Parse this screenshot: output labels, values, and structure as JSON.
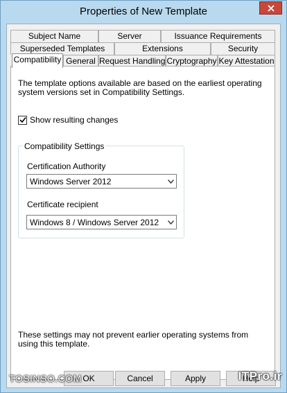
{
  "window": {
    "title": "Properties of New Template"
  },
  "tabs": {
    "row1": [
      "Subject Name",
      "Server",
      "Issuance Requirements"
    ],
    "row2": [
      "Superseded Templates",
      "Extensions",
      "Security"
    ],
    "row3": [
      "Compatibility",
      "General",
      "Request Handling",
      "Cryptography",
      "Key Attestation"
    ],
    "active": "Compatibility"
  },
  "panel": {
    "intro_text": "The template options available are based on the earliest operating system versions set in Compatibility Settings.",
    "show_changes_label": "Show resulting changes",
    "show_changes_checked": true,
    "group_title": "Compatibility Settings",
    "ca_label": "Certification Authority",
    "ca_value": "Windows Server 2012",
    "recipient_label": "Certificate recipient",
    "recipient_value": "Windows 8 / Windows Server 2012",
    "footer_note": "These settings may not prevent earlier operating systems from using this template."
  },
  "buttons": {
    "ok": "OK",
    "cancel": "Cancel",
    "apply": "Apply",
    "help": "Help"
  },
  "watermark": {
    "left": "TOSINSO.COM",
    "right": "ITPro.ir"
  },
  "colors": {
    "frame": "#b9d9ee",
    "close": "#c7483b",
    "panel": "#ffffff"
  }
}
